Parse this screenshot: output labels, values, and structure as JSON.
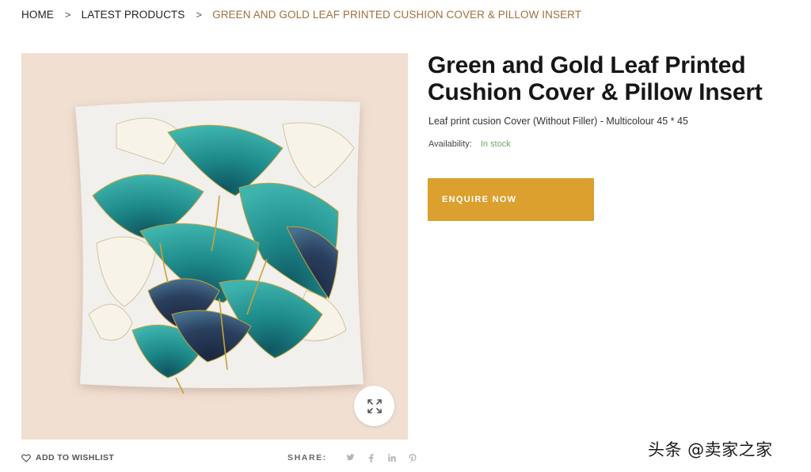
{
  "breadcrumb": {
    "home": "HOME",
    "category": "LATEST PRODUCTS",
    "current": "GREEN AND GOLD LEAF PRINTED CUSHION COVER & PILLOW INSERT",
    "separator": ">"
  },
  "product": {
    "title": "Green and Gold Leaf Printed Cushion Cover & Pillow Insert",
    "description": "Leaf print cusion Cover (Without Filler) - Multicolour 45 * 45",
    "availability_label": "Availability:",
    "availability_value": "In stock",
    "enquire_label": "ENQUIRE NOW"
  },
  "gallery": {
    "zoom_icon": "expand-icon"
  },
  "actions": {
    "wishlist_label": "ADD TO WISHLIST",
    "wishlist_icon": "heart-icon",
    "share_label": "SHARE:",
    "share_icons": [
      "twitter-icon",
      "facebook-icon",
      "linkedin-icon",
      "pinterest-icon"
    ]
  },
  "watermark": "头条 @卖家之家",
  "colors": {
    "accent": "#dba02d",
    "breadcrumb_current": "#a0713b",
    "in_stock": "#77a464",
    "gallery_bg": "#f1dfd1",
    "teal": "#1f8c8c",
    "gold": "#c9a236"
  }
}
